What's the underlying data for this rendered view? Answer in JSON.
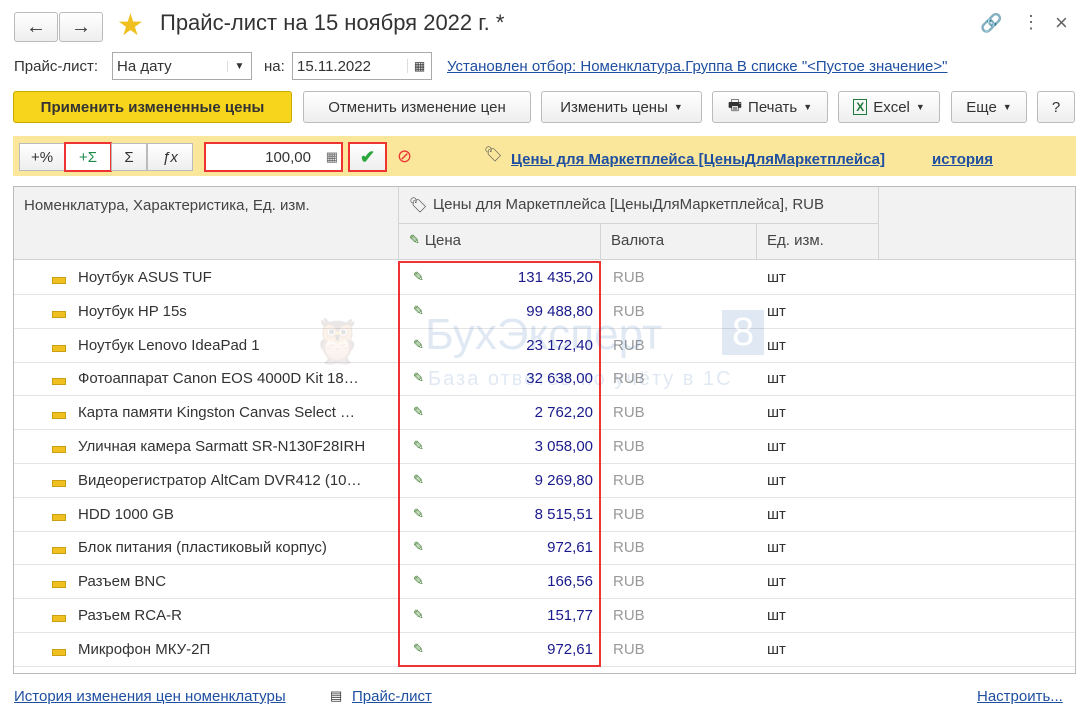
{
  "window": {
    "title": "Прайс-лист на 15 ноября 2022 г. *"
  },
  "filter": {
    "price_list_label": "Прайс-лист:",
    "price_list_value": "На дату",
    "date_label": "на:",
    "date_value": "15.11.2022",
    "selection_link": "Установлен отбор: Номенклатура.Группа В списке \"<Пустое значение>\""
  },
  "toolbar": {
    "apply": "Применить измененные цены",
    "cancel": "Отменить изменение цен",
    "change": "Изменить цены",
    "print": "Печать",
    "excel": "Excel",
    "more": "Еще",
    "help": "?"
  },
  "edit_bar": {
    "percent": "+%",
    "plus_sum": "+Σ",
    "sum": "Σ",
    "fx": "ƒx",
    "value": "100,00",
    "price_type_link": "Цены для Маркетплейса [ЦеныДляМаркетплейса]",
    "history_link": "история"
  },
  "table": {
    "headers": {
      "name": "Номенклатура, Характеристика, Ед. изм.",
      "group": "Цены для Маркетплейса [ЦеныДляМаркетплейса], RUB",
      "price": "Цена",
      "currency": "Валюта",
      "unit": "Ед. изм."
    },
    "rows": [
      {
        "name": "Ноутбук ASUS TUF",
        "price": "131 435,20",
        "currency": "RUB",
        "unit": "шт"
      },
      {
        "name": "Ноутбук HP 15s",
        "price": "99 488,80",
        "currency": "RUB",
        "unit": "шт"
      },
      {
        "name": "Ноутбук Lenovo IdeaPad 1",
        "price": "23 172,40",
        "currency": "RUB",
        "unit": "шт"
      },
      {
        "name": "Фотоаппарат Canon EOS 4000D Kit 18…",
        "price": "32 638,00",
        "currency": "RUB",
        "unit": "шт"
      },
      {
        "name": "Карта памяти Kingston Canvas Select …",
        "price": "2 762,20",
        "currency": "RUB",
        "unit": "шт"
      },
      {
        "name": "Уличная камера Sarmatt SR-N130F28IRH",
        "price": "3 058,00",
        "currency": "RUB",
        "unit": "шт"
      },
      {
        "name": "Видеорегистратор AltCam DVR412 (10…",
        "price": "9 269,80",
        "currency": "RUB",
        "unit": "шт"
      },
      {
        "name": "HDD 1000 GB",
        "price": "8 515,51",
        "currency": "RUB",
        "unit": "шт"
      },
      {
        "name": "Блок питания (пластиковый корпус)",
        "price": "972,61",
        "currency": "RUB",
        "unit": "шт"
      },
      {
        "name": "Разъем BNC",
        "price": "166,56",
        "currency": "RUB",
        "unit": "шт"
      },
      {
        "name": "Разъем RCA-R",
        "price": "151,77",
        "currency": "RUB",
        "unit": "шт"
      },
      {
        "name": "Микрофон МКУ-2П",
        "price": "972,61",
        "currency": "RUB",
        "unit": "шт"
      }
    ]
  },
  "watermark": {
    "brand": "БухЭксперт",
    "num": "8",
    "tagline": "База ответов по учёту в 1С"
  },
  "footer": {
    "history": "История изменения цен номенклатуры",
    "price_list": "Прайс-лист",
    "settings": "Настроить..."
  }
}
